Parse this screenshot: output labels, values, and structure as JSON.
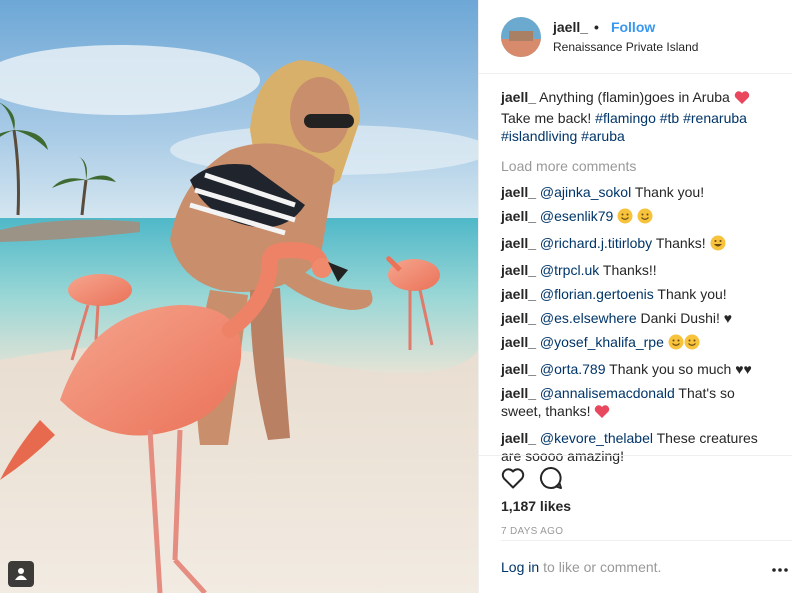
{
  "header": {
    "username": "jaell_",
    "separator": "•",
    "follow_label": "Follow",
    "location": "Renaissance Private Island"
  },
  "caption": {
    "username": "jaell_",
    "text": "Anything (flamin)goes in Aruba",
    "text2": "Take me back!",
    "hashtags": [
      "#flamingo",
      "#tb",
      "#renaruba",
      "#islandliving",
      "#aruba"
    ]
  },
  "load_more": "Load more comments",
  "comments": [
    {
      "user": "jaell_",
      "mention": "@ajinka_sokol",
      "text": "Thank you!"
    },
    {
      "user": "jaell_",
      "mention": "@esenlik79",
      "text": ""
    },
    {
      "user": "jaell_",
      "mention": "@richard.j.titirloby",
      "text": "Thanks!"
    },
    {
      "user": "jaell_",
      "mention": "@trpcl.uk",
      "text": "Thanks!!"
    },
    {
      "user": "jaell_",
      "mention": "@florian.gertoenis",
      "text": "Thank you!"
    },
    {
      "user": "jaell_",
      "mention": "@es.elsewhere",
      "text": "Danki Dushi! ♥"
    },
    {
      "user": "jaell_",
      "mention": "@yosef_khalifa_rpe",
      "text": ""
    },
    {
      "user": "jaell_",
      "mention": "@orta.789",
      "text": "Thank you so much ♥♥"
    },
    {
      "user": "jaell_",
      "mention": "@annalisemacdonald",
      "text": "That's so sweet, thanks!"
    },
    {
      "user": "jaell_",
      "mention": "@kevore_thelabel",
      "text": "These creatures are soooo amazing!"
    }
  ],
  "likes": "1,187 likes",
  "timestamp": "7 DAYS AGO",
  "login": {
    "link": "Log in",
    "rest": "to like or comment."
  },
  "icons": {
    "like": "heart-outline-icon",
    "comment": "comment-bubble-icon",
    "more": "more-options-icon",
    "tag": "person-tag-icon"
  },
  "colors": {
    "link": "#003569",
    "follow": "#3897f0",
    "muted": "#999999",
    "heart": "#ed4956"
  }
}
